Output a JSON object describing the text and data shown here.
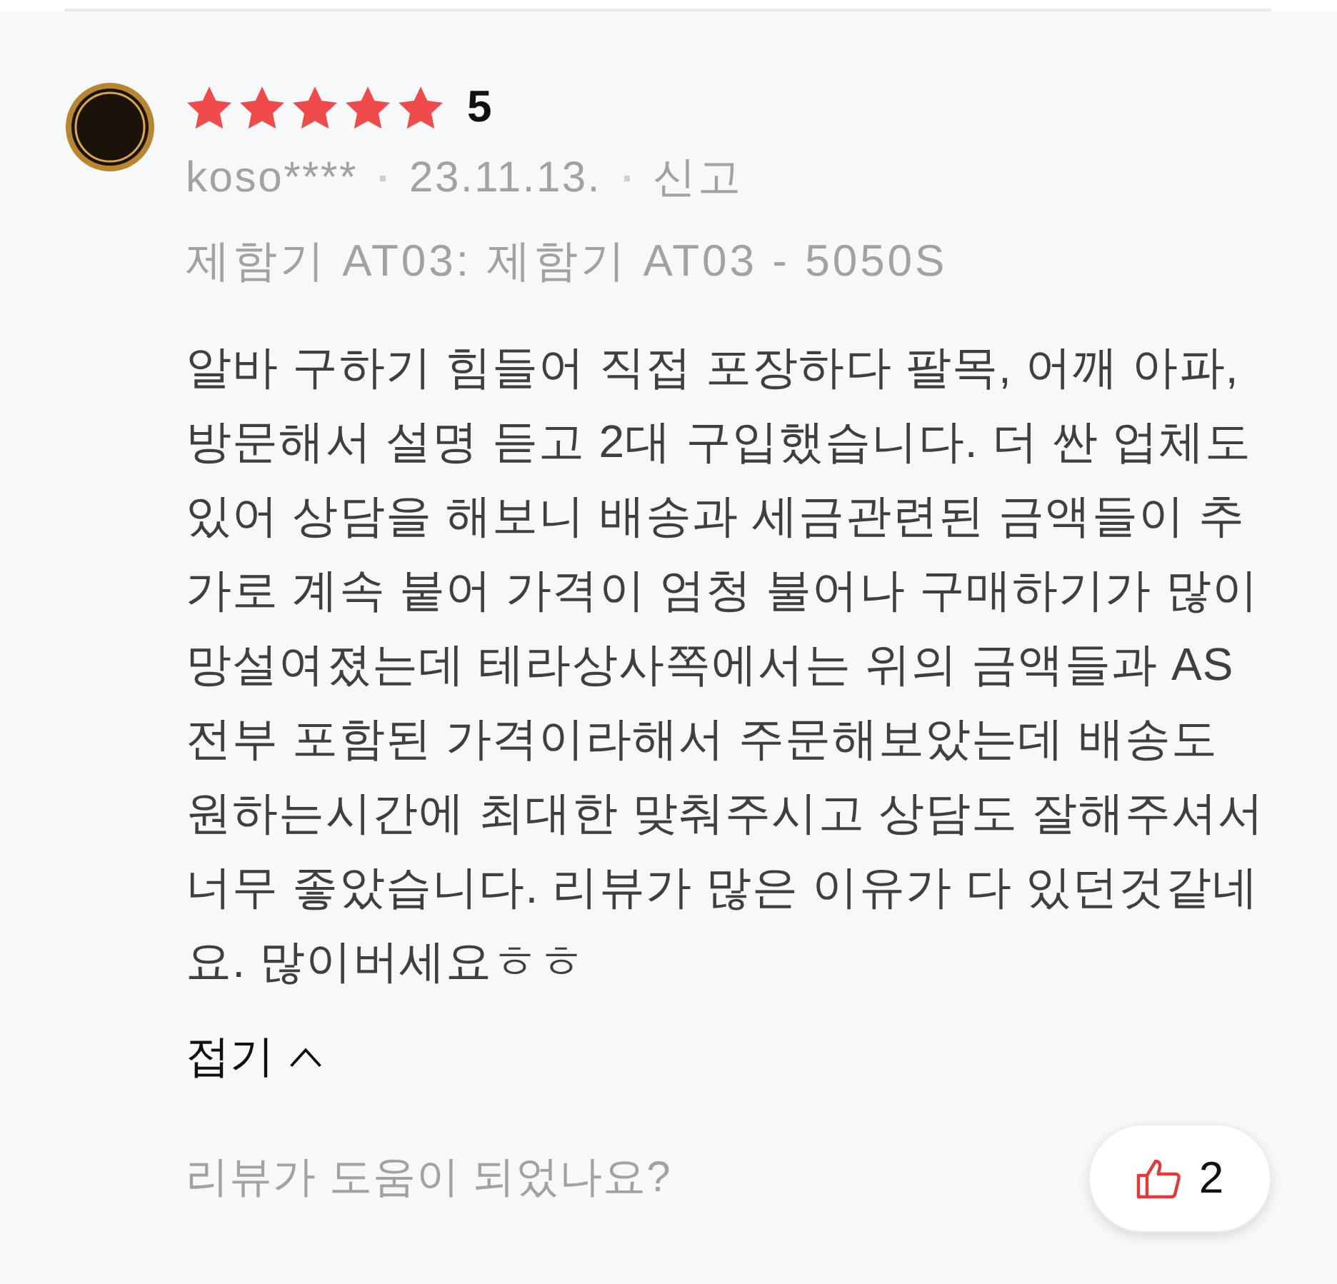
{
  "review": {
    "rating": {
      "stars": 5,
      "score": "5"
    },
    "author": "koso****",
    "date": "23.11.13.",
    "report_link": "신고",
    "product_option": "제함기 AT03: 제함기 AT03 - 5050S",
    "body": "알바 구하기 힘들어 직접 포장하다 팔목, 어깨 아파, 방문해서 설명 듣고 2대 구입했습니다. 더 싼 업체도 있어 상담을 해보니 배송과 세금관련된 금액들이 추가로 계속 붙어 가격이 엄청 불어나 구매하기가 많이 망설여졌는데 테라상사쪽에서는 위의 금액들과 AS 전부 포함된 가격이라해서 주문해보았는데 배송도 원하는시간에 최대한 맞춰주시고 상담도 잘해주셔서 너무 좋았습니다. 리뷰가 많은 이유가 다 있던것같네요. 많이버세요ㅎㅎ",
    "collapse_button": "접기",
    "helpful_prompt": "리뷰가 도움이 되었나요?",
    "helpful_button": {
      "count": "2"
    }
  }
}
